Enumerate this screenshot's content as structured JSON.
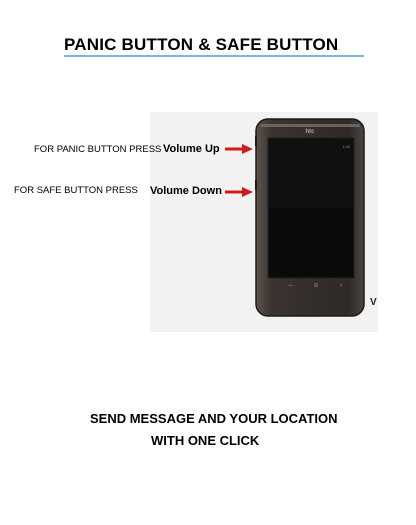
{
  "header": {
    "title": "PANIC BUTTON & SAFE BUTTON"
  },
  "instructions": {
    "panic_label": "FOR PANIC BUTTON PRESS",
    "safe_label": "FOR SAFE BUTTON PRESS",
    "volume_up": "Volume Up",
    "volume_down": "Volume Down",
    "cut_letter": "V"
  },
  "phone": {
    "brand": "htc",
    "time": "1:45"
  },
  "footer": {
    "line1": "SEND MESSAGE AND YOUR LOCATION",
    "line2": "WITH ONE CLICK"
  },
  "colors": {
    "arrow": "#d11a1a",
    "underline": "#7fb4dd",
    "phone_body": "#3a3330"
  }
}
